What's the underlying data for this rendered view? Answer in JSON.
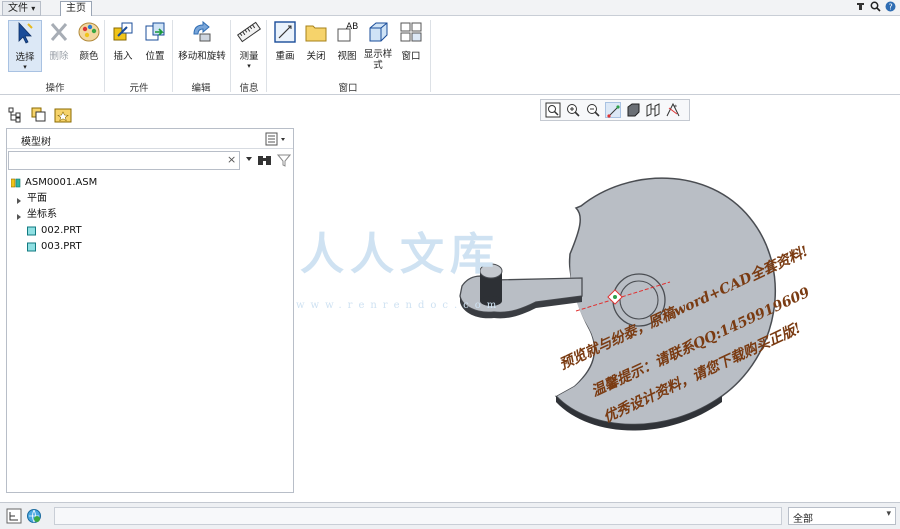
{
  "tabs": {
    "file": "文件",
    "file_arrow": "▾",
    "home": "主页"
  },
  "ribbon": {
    "buttons": {
      "select": "选择",
      "select_sub": "▾",
      "delete": "删除",
      "color": "颜色",
      "insert": "插入",
      "position": "位置",
      "move_rotate": "移动和旋转",
      "measure": "测量",
      "measure_sub": "▾",
      "redraw": "重画",
      "close": "关闭",
      "view": "视图",
      "display_style": "显示样",
      "display_style_2": "式",
      "display_style_sub": "▾",
      "window": "窗口"
    },
    "groups": {
      "operations": "操作",
      "components": "元件",
      "edit": "编辑",
      "info": "信息",
      "window": "窗口"
    }
  },
  "panel": {
    "title": "模型树",
    "search": {
      "value": "",
      "placeholder": ""
    },
    "clear": "×",
    "tree": [
      {
        "label": "ASM0001.ASM",
        "type": "assembly"
      },
      {
        "label": "平面",
        "type": "folder"
      },
      {
        "label": "坐标系",
        "type": "folder"
      },
      {
        "label": "002.PRT",
        "type": "part"
      },
      {
        "label": "003.PRT",
        "type": "part"
      }
    ]
  },
  "status": {
    "filter": "全部",
    "filter_arrow": "▾"
  },
  "watermark": {
    "big": "人人文库",
    "url": "www.renrendoc.com",
    "line1": "预览就与纷泰，原稿word+CAD全套资料!",
    "line2": "温馨提示：请联系QQ:1459919609",
    "line3": "优秀设计资料，请您下载购买正版!"
  },
  "icons": {
    "select": "arrow-cursor-icon",
    "delete": "x-delete-icon",
    "color": "palette-icon",
    "insert": "insert-component-icon",
    "position": "position-icon",
    "move": "move-rotate-icon",
    "measure": "ruler-icon",
    "redraw": "redraw-icon",
    "close": "close-folder-icon",
    "view": "view-ab-icon",
    "display": "cube-display-icon",
    "window": "window-icon"
  },
  "colors": {
    "accent": "#2f6db3",
    "model": "#b9bec5",
    "edge": "#4a4d52"
  }
}
